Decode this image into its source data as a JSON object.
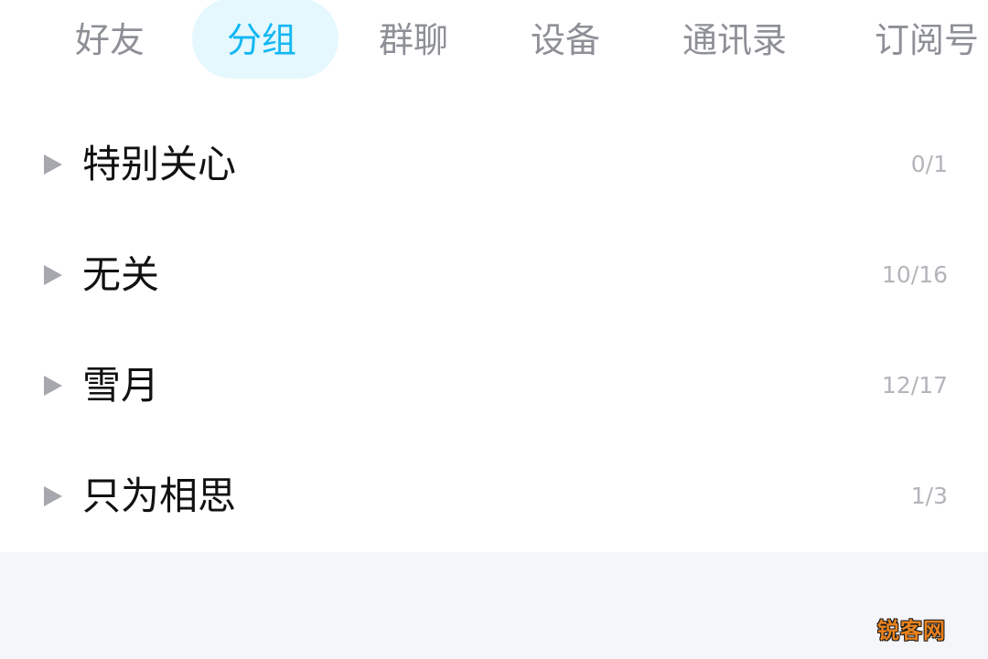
{
  "tabs": [
    {
      "label": "好友",
      "active": false
    },
    {
      "label": "分组",
      "active": true
    },
    {
      "label": "群聊",
      "active": false
    },
    {
      "label": "设备",
      "active": false
    },
    {
      "label": "通讯录",
      "active": false
    },
    {
      "label": "订阅号",
      "active": false
    }
  ],
  "groups": [
    {
      "name": "特别关心",
      "count": "0/1"
    },
    {
      "name": "无关",
      "count": "10/16"
    },
    {
      "name": "雪月",
      "count": "12/17"
    },
    {
      "name": "只为相思",
      "count": "1/3"
    }
  ],
  "icons": {
    "group_arrow": "caret-right-icon"
  },
  "colors": {
    "accent": "#12b7f5",
    "active_tab_background": "#e4f8fd",
    "tab_text": "#8e9097",
    "group_name": "#111111",
    "group_count": "#b3b5ba",
    "bottom_background": "#f5f6fa"
  },
  "watermark": "锐客网"
}
